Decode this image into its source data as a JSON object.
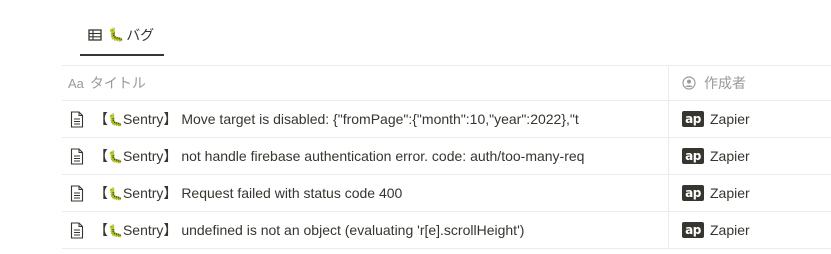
{
  "breadcrumb_fragment": "’ ’",
  "tab": {
    "icon": "table-icon",
    "emoji": "🐛",
    "label": "バグ"
  },
  "columns": [
    {
      "label": "タイトル",
      "prefix": "Aa",
      "icon": "text-type-icon"
    },
    {
      "label": "作成者",
      "icon": "person-icon"
    }
  ],
  "rows": [
    {
      "icon": "page-icon",
      "title_open": "【",
      "title_emoji": "🐛",
      "title_tag": "Sentry】",
      "title_rest": "Move target is disabled: {\"fromPage\":{\"month\":10,\"year\":2022},\"t",
      "creator_logo": "ap",
      "creator": "Zapier"
    },
    {
      "icon": "page-icon",
      "title_open": "【",
      "title_emoji": "🐛",
      "title_tag": "Sentry】",
      "title_rest": "not handle firebase authentication error. code: auth/too-many-req",
      "creator_logo": "ap",
      "creator": "Zapier"
    },
    {
      "icon": "page-icon",
      "title_open": "【",
      "title_emoji": "🐛",
      "title_tag": "Sentry】",
      "title_rest": "Request failed with status code 400",
      "creator_logo": "ap",
      "creator": "Zapier"
    },
    {
      "icon": "page-icon",
      "title_open": "【",
      "title_emoji": "🐛",
      "title_tag": "Sentry】",
      "title_rest": "undefined is not an object (evaluating 'r[e].scrollHeight')",
      "creator_logo": "ap",
      "creator": "Zapier"
    }
  ]
}
